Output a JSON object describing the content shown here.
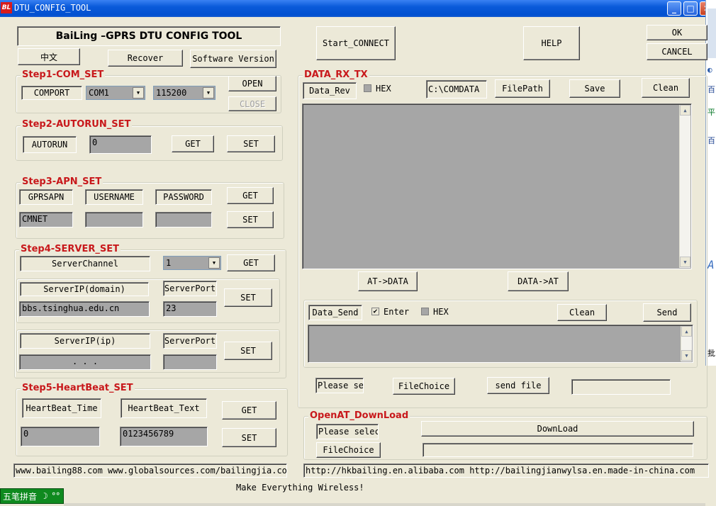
{
  "window": {
    "title": "DTU_CONFIG_TOOL",
    "logo": "BL"
  },
  "header": {
    "app_title": "BaiLing –GPRS DTU CONFIG TOOL",
    "lang_button": "中文",
    "recover_button": "Recover",
    "version_button": "Software Version",
    "start_connect": "Start_CONNECT",
    "help": "HELP",
    "ok": "OK",
    "cancel": "CANCEL"
  },
  "step1": {
    "title": "Step1-COM_SET",
    "comport_label": "COMPORT",
    "com_value": "COM1",
    "baud_value": "115200",
    "open": "OPEN",
    "close": "CLOSE"
  },
  "step2": {
    "title": "Step2-AUTORUN_SET",
    "label": "AUTORUN",
    "value": "0",
    "get": "GET",
    "set": "SET"
  },
  "step3": {
    "title": "Step3-APN_SET",
    "apn_label": "GPRSAPN",
    "user_label": "USERNAME",
    "pass_label": "PASSWORD",
    "apn_value": "CMNET",
    "user_value": "",
    "pass_value": "",
    "get": "GET",
    "set": "SET"
  },
  "step4": {
    "title": "Step4-SERVER_SET",
    "channel_label": "ServerChannel",
    "channel_value": "1",
    "get": "GET",
    "domain_label": "ServerIP(domain)",
    "port_label": "ServerPort",
    "domain_value": "bbs.tsinghua.edu.cn",
    "port_value": "23",
    "set1": "SET",
    "ip_label": "ServerIP(ip)",
    "port2_label": "ServerPort",
    "ip_value": ".       .       .",
    "port2_value": "",
    "set2": "SET"
  },
  "step5": {
    "title": "Step5-HeartBeat_SET",
    "time_label": "HeartBeat_Time",
    "text_label": "HeartBeat_Text",
    "time_value": "0",
    "text_value": "0123456789",
    "get": "GET",
    "set": "SET"
  },
  "data_rx": {
    "title": "DATA_RX_TX",
    "rev_label": "Data_Rev",
    "hex_label": "HEX",
    "path_value": "C:\\COMDATA",
    "filepath": "FilePath",
    "save": "Save",
    "clean": "Clean",
    "at_data": "AT->DATA",
    "data_at": "DATA->AT",
    "send_label": "Data_Send",
    "enter_label": "Enter",
    "enter_checked": "✔",
    "hex2_label": "HEX",
    "clean2": "Clean",
    "send": "Send",
    "file_field": "Please se",
    "file_choice": "FileChoice",
    "send_file": "send file"
  },
  "openat": {
    "title": "OpenAT_DownLoad",
    "file_field": "Please selec",
    "download": "DownLoad",
    "file_choice": "FileChoice"
  },
  "footer": {
    "left_links": "www.bailing88.com  www.globalsources.com/bailingjia.co",
    "right_links": "http://hkbailing.en.alibaba.com   http://bailingjianwylsa.en.made-in-china.com",
    "slogan": "Make Everything Wireless!"
  },
  "ime": {
    "label": "五笔拼音",
    "moon": "☽",
    "dots": "°°"
  },
  "right_edge": {
    "chars": [
      "百",
      "平",
      "百",
      "A",
      "批"
    ]
  },
  "colors": {
    "group_title": "#c8181b",
    "titlebar": "#0a5ad9",
    "dialog_bg": "#ece9d8",
    "field_bg": "#a6a6a6",
    "ime_bg": "#0f8a1f"
  }
}
